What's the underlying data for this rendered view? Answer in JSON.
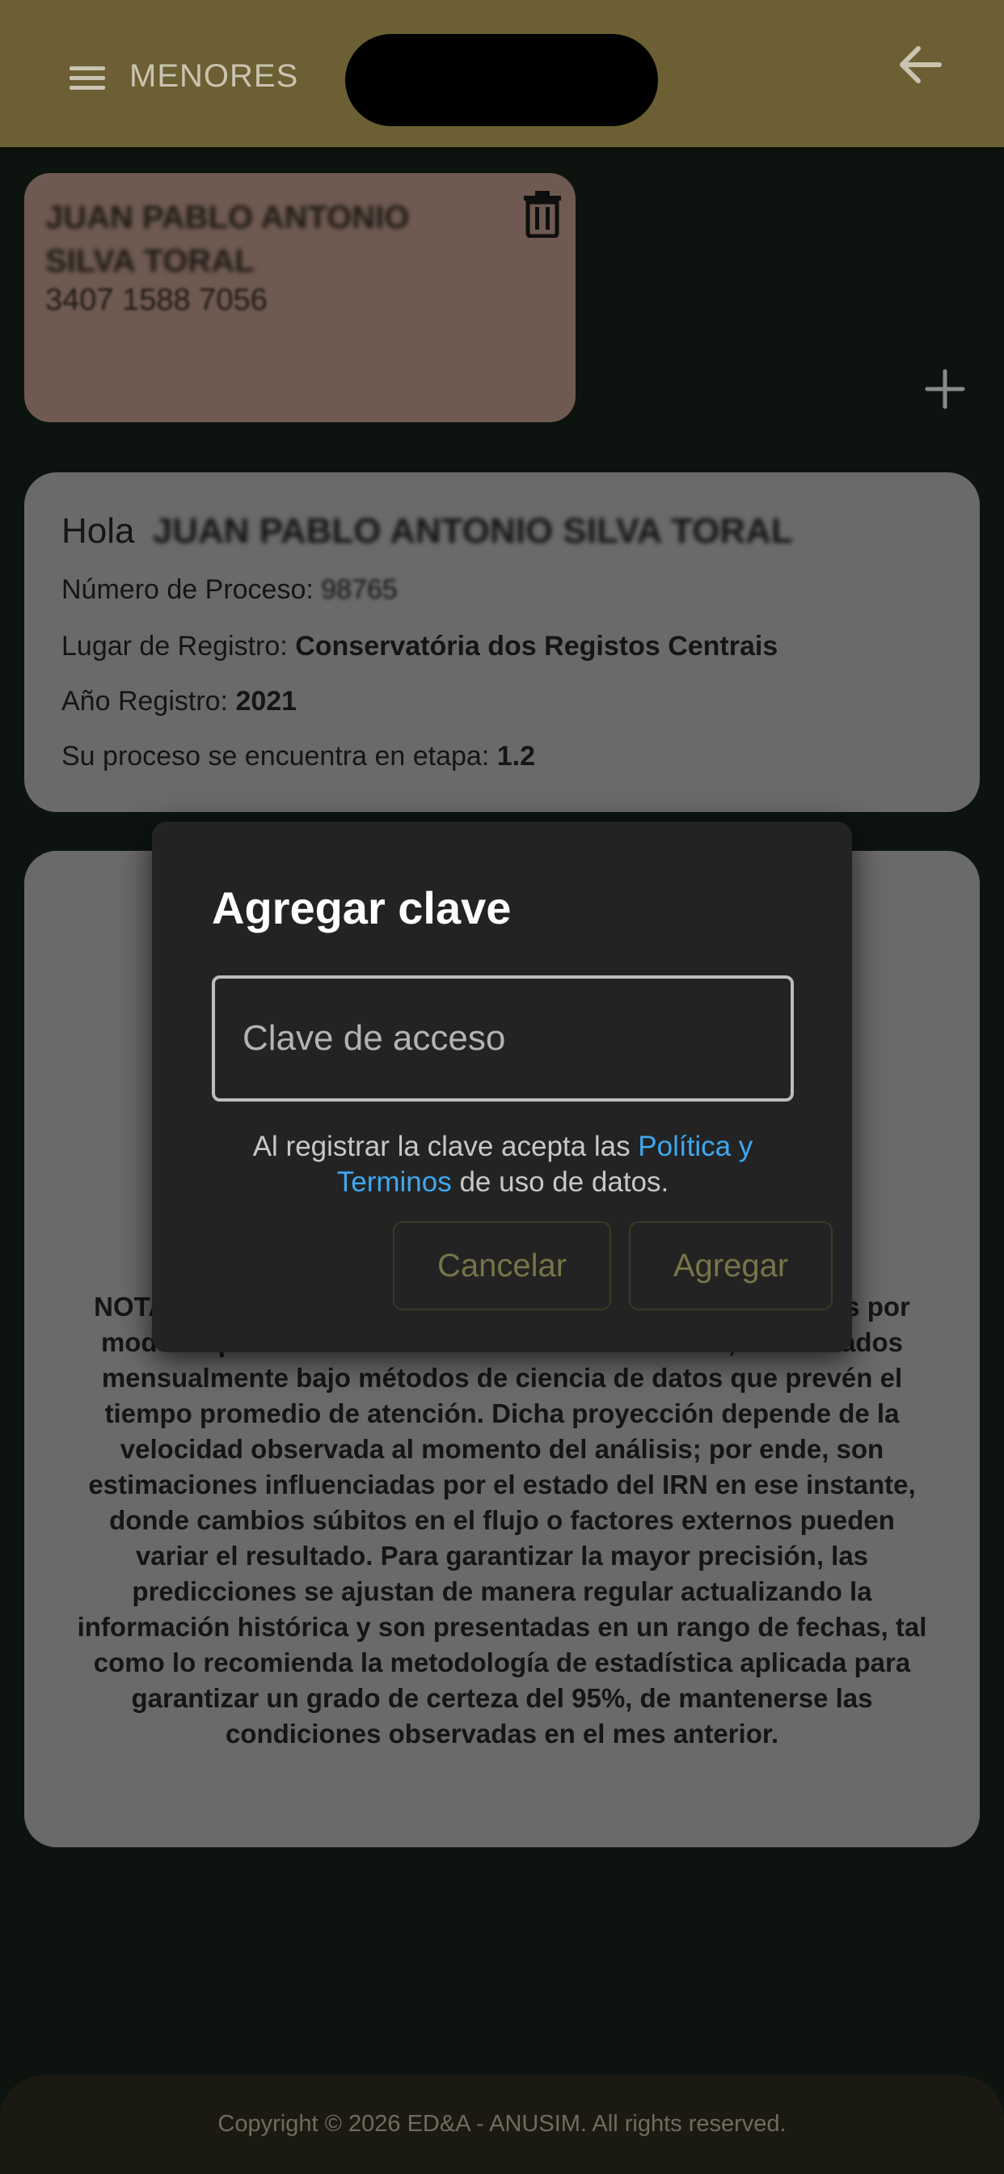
{
  "header": {
    "title": "MENORES"
  },
  "minor_card": {
    "name": "JUAN PABLO ANTONIO SILVA TORAL",
    "id_number": "3407 1588 7056"
  },
  "info_card": {
    "greeting": "Hola",
    "greeting_name": "JUAN PABLO ANTONIO SILVA TORAL",
    "process_number_label": "Número de Proceso:",
    "process_number_value": "98765",
    "registry_place_label": "Lugar de Registro:",
    "registry_place_value": "Conservatória dos Registos Centrais",
    "registry_year_label": "Año Registro:",
    "registry_year_value": "2021",
    "stage_label": "Su proceso se encuentra en etapa:",
    "stage_value": "1.2"
  },
  "note_card": {
    "text": "NOTA: Los tiempos mostrados son proyecciones generadas por modelos predictivos basados en datos históricos, actualizados mensualmente bajo métodos de ciencia de datos que prevén el tiempo promedio de atención. Dicha proyección depende de la velocidad observada al momento del análisis; por ende, son estimaciones influenciadas por el estado del IRN en ese instante, donde cambios súbitos en el flujo o factores externos pueden variar el resultado. Para garantizar la mayor precisión, las predicciones se ajustan de manera regular actualizando la información histórica y son presentadas en un rango de fechas, tal como lo recomienda la metodología de estadística aplicada para garantizar un grado de certeza del 95%, de mantenerse las condiciones observadas en el mes anterior."
  },
  "dialog": {
    "title": "Agregar clave",
    "input_placeholder": "Clave de acceso",
    "input_value": "",
    "terms_prefix": "Al registrar la clave acepta las ",
    "terms_link": "Política y Terminos",
    "terms_suffix": " de uso de datos.",
    "cancel_label": "Cancelar",
    "add_label": "Agregar"
  },
  "footer": {
    "copyright": "Copyright © 2026 ED&A - ANUSIM. All rights reserved."
  },
  "colors": {
    "topbar": "#6b5f33",
    "dialog_bg": "#232323",
    "link": "#3ea8f0",
    "button_text": "#777548"
  }
}
